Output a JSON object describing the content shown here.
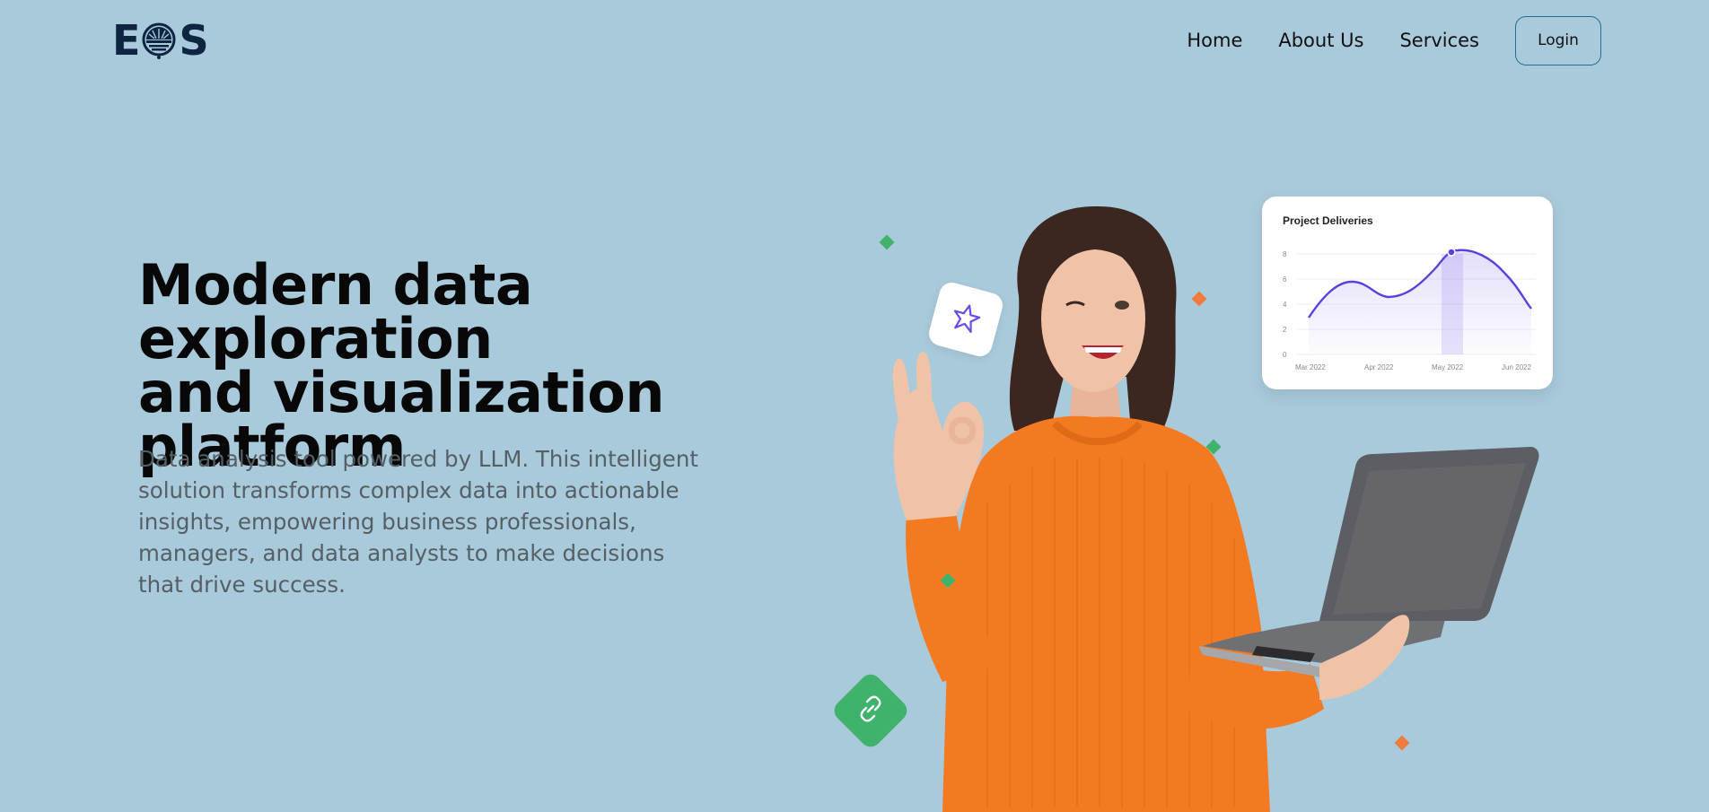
{
  "brand": {
    "logo_left": "E",
    "logo_right": "S",
    "colors": {
      "navy": "#0d2540",
      "background": "#a9cadb",
      "accent_green": "#3fb26b",
      "accent_orange": "#f07b3f",
      "chart_purple": "#5b3fe0"
    }
  },
  "nav": {
    "home": "Home",
    "about": "About Us",
    "services": "Services",
    "login": "Login"
  },
  "hero": {
    "title_line1": "Modern data exploration",
    "title_line2": "and visualization",
    "title_line3": "platform",
    "description_line1": "Data analysis tool powered by LLM. This intelligent",
    "description_line2": "solution transforms complex data into actionable",
    "description_line3": "insights, empowering business professionals,",
    "description_line4": "managers, and data analysts to make decisions",
    "description_line5": "that drive success."
  },
  "widget": {
    "title": "Project Deliveries",
    "y_ticks": [
      "8",
      "6",
      "4",
      "2",
      "0"
    ],
    "x_ticks": [
      "Mar 2022",
      "Apr 2022",
      "May 2022",
      "Jun 2022"
    ]
  },
  "icons": {
    "star_tile": "star-icon",
    "green_tile": "link-icon",
    "logo_emblem": "compass-emblem-icon"
  }
}
